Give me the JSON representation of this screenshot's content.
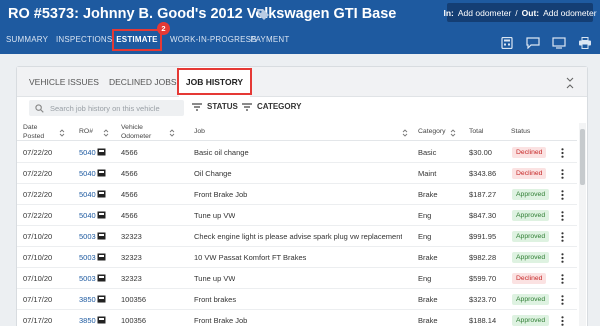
{
  "header": {
    "title": "RO #5373: Johnny B. Good's 2012 Volkswagen GTI Base",
    "odometer": {
      "in_label": "In:",
      "in_value": "Add odometer",
      "separator": "/",
      "out_label": "Out:",
      "out_value": "Add odometer"
    }
  },
  "nav": {
    "tabs": [
      "SUMMARY",
      "INSPECTIONS",
      "ESTIMATE",
      "WORK-IN-PROGRESS",
      "PAYMENT"
    ],
    "active": "ESTIMATE",
    "badge": "2"
  },
  "subtabs": {
    "items": [
      "VEHICLE ISSUES",
      "DECLINED JOBS",
      "JOB HISTORY"
    ],
    "active": "JOB HISTORY"
  },
  "search": {
    "placeholder": "Search job history on this vehicle",
    "value": ""
  },
  "filters": {
    "status": "STATUS",
    "category": "CATEGORY"
  },
  "table": {
    "columns": {
      "date": "Date\nPosted",
      "ro": "RO#",
      "odometer": "Vehicle\nOdometer",
      "job": "Job",
      "category": "Category",
      "total": "Total",
      "status": "Status"
    },
    "rows": [
      {
        "date": "07/22/20",
        "ro": "5040",
        "odometer": "4566",
        "job": "Basic oil change",
        "category": "Basic",
        "total": "$30.00",
        "status": "Declined"
      },
      {
        "date": "07/22/20",
        "ro": "5040",
        "odometer": "4566",
        "job": "Oil Change",
        "category": "Maint",
        "total": "$343.86",
        "status": "Declined"
      },
      {
        "date": "07/22/20",
        "ro": "5040",
        "odometer": "4566",
        "job": "Front Brake Job",
        "category": "Brake",
        "total": "$187.27",
        "status": "Approved"
      },
      {
        "date": "07/22/20",
        "ro": "5040",
        "odometer": "4566",
        "job": "Tune up VW",
        "category": "Eng",
        "total": "$847.30",
        "status": "Approved"
      },
      {
        "date": "07/10/20",
        "ro": "5003",
        "odometer": "32323",
        "job": "Check engine light is please advise spark plug vw replacement",
        "category": "Eng",
        "total": "$991.95",
        "status": "Approved"
      },
      {
        "date": "07/10/20",
        "ro": "5003",
        "odometer": "32323",
        "job": "10 VW Passat Komfort FT Brakes",
        "category": "Brake",
        "total": "$982.28",
        "status": "Approved"
      },
      {
        "date": "07/10/20",
        "ro": "5003",
        "odometer": "32323",
        "job": "Tune up VW",
        "category": "Eng",
        "total": "$599.70",
        "status": "Declined"
      },
      {
        "date": "07/17/20",
        "ro": "3850",
        "odometer": "100356",
        "job": "Front brakes",
        "category": "Brake",
        "total": "$323.70",
        "status": "Approved"
      },
      {
        "date": "07/17/20",
        "ro": "3850",
        "odometer": "100356",
        "job": "Front Brake Job",
        "category": "Brake",
        "total": "$188.14",
        "status": "Approved"
      }
    ]
  },
  "colors": {
    "header": "#1e5aa0",
    "highlight": "#e53935",
    "declined": "#c62828",
    "approved": "#2e7d32"
  },
  "icons": [
    "tag-icon",
    "calculator-icon",
    "chat-icon",
    "monitor-icon",
    "print-icon",
    "collapse-icon",
    "search-icon",
    "filter-icon",
    "car-icon",
    "kebab-menu-icon",
    "sort-icon"
  ]
}
